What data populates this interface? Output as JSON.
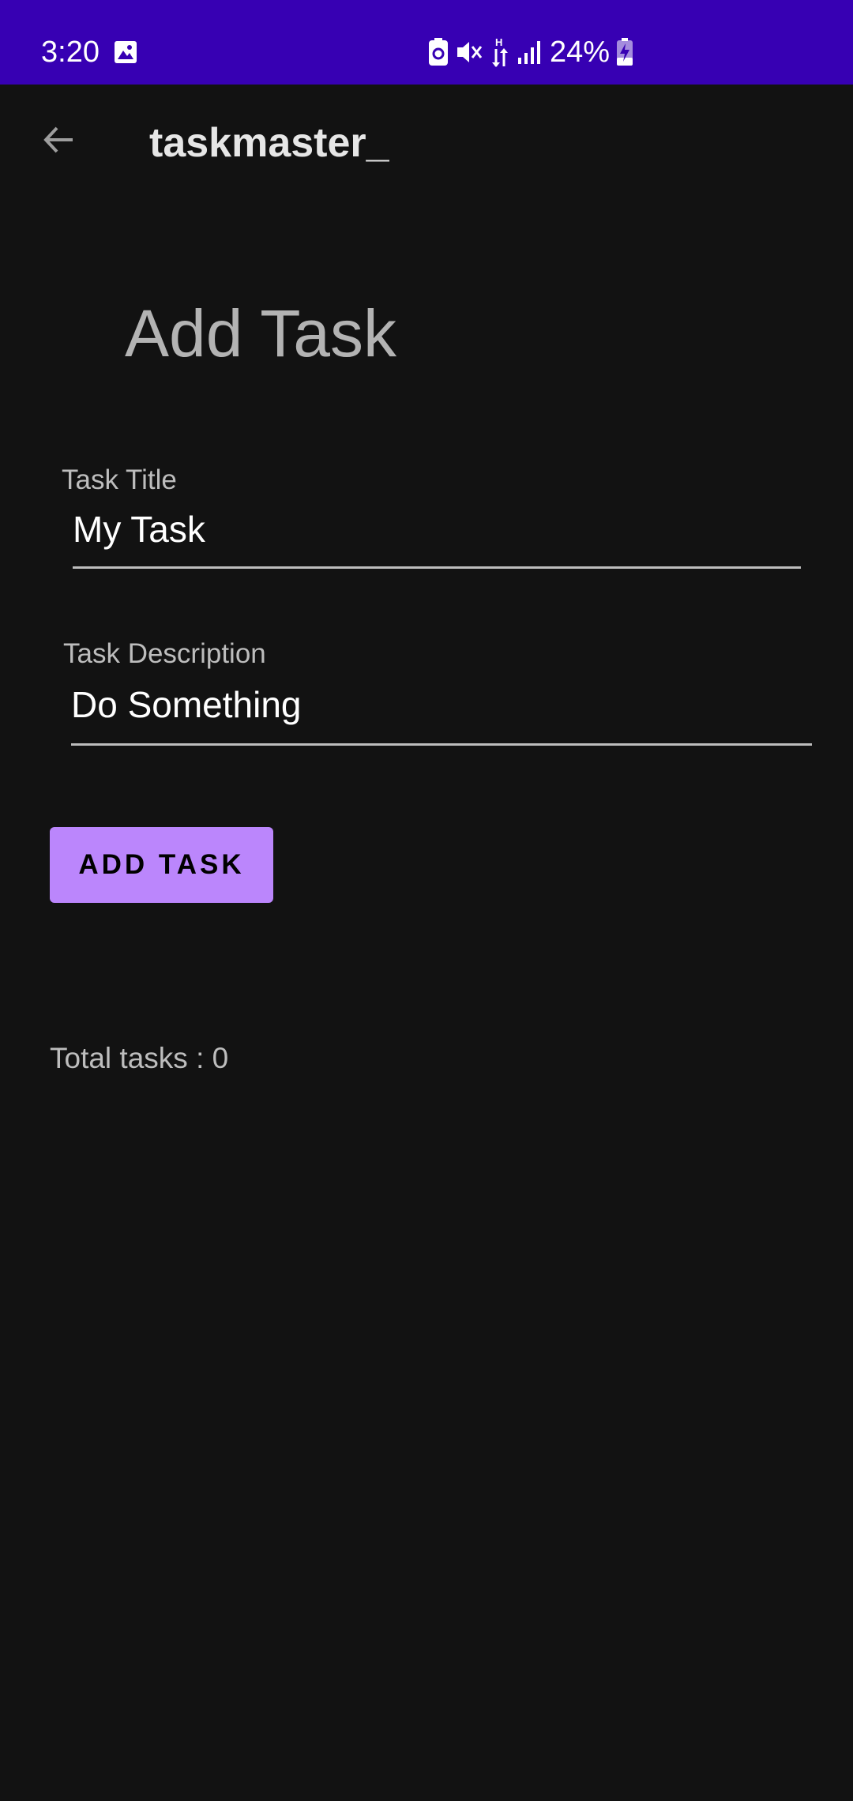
{
  "status_bar": {
    "time": "3:20",
    "battery": "24%",
    "color": "#3700b3",
    "icons": [
      "gallery-icon",
      "battery-saver-icon",
      "mute-icon",
      "data-arrows-icon",
      "signal-icon",
      "charging-battery-icon"
    ]
  },
  "app_bar": {
    "title": "taskmaster_",
    "back_icon": "arrow-left-icon"
  },
  "main": {
    "heading": "Add Task",
    "title_field": {
      "label": "Task Title",
      "value": "My Task"
    },
    "description_field": {
      "label": "Task Description",
      "value": "Do Something"
    },
    "add_button_label": "ADD TASK",
    "total_tasks": "Total tasks : 0"
  },
  "colors": {
    "background": "#121212",
    "accent": "#bb86fc"
  }
}
